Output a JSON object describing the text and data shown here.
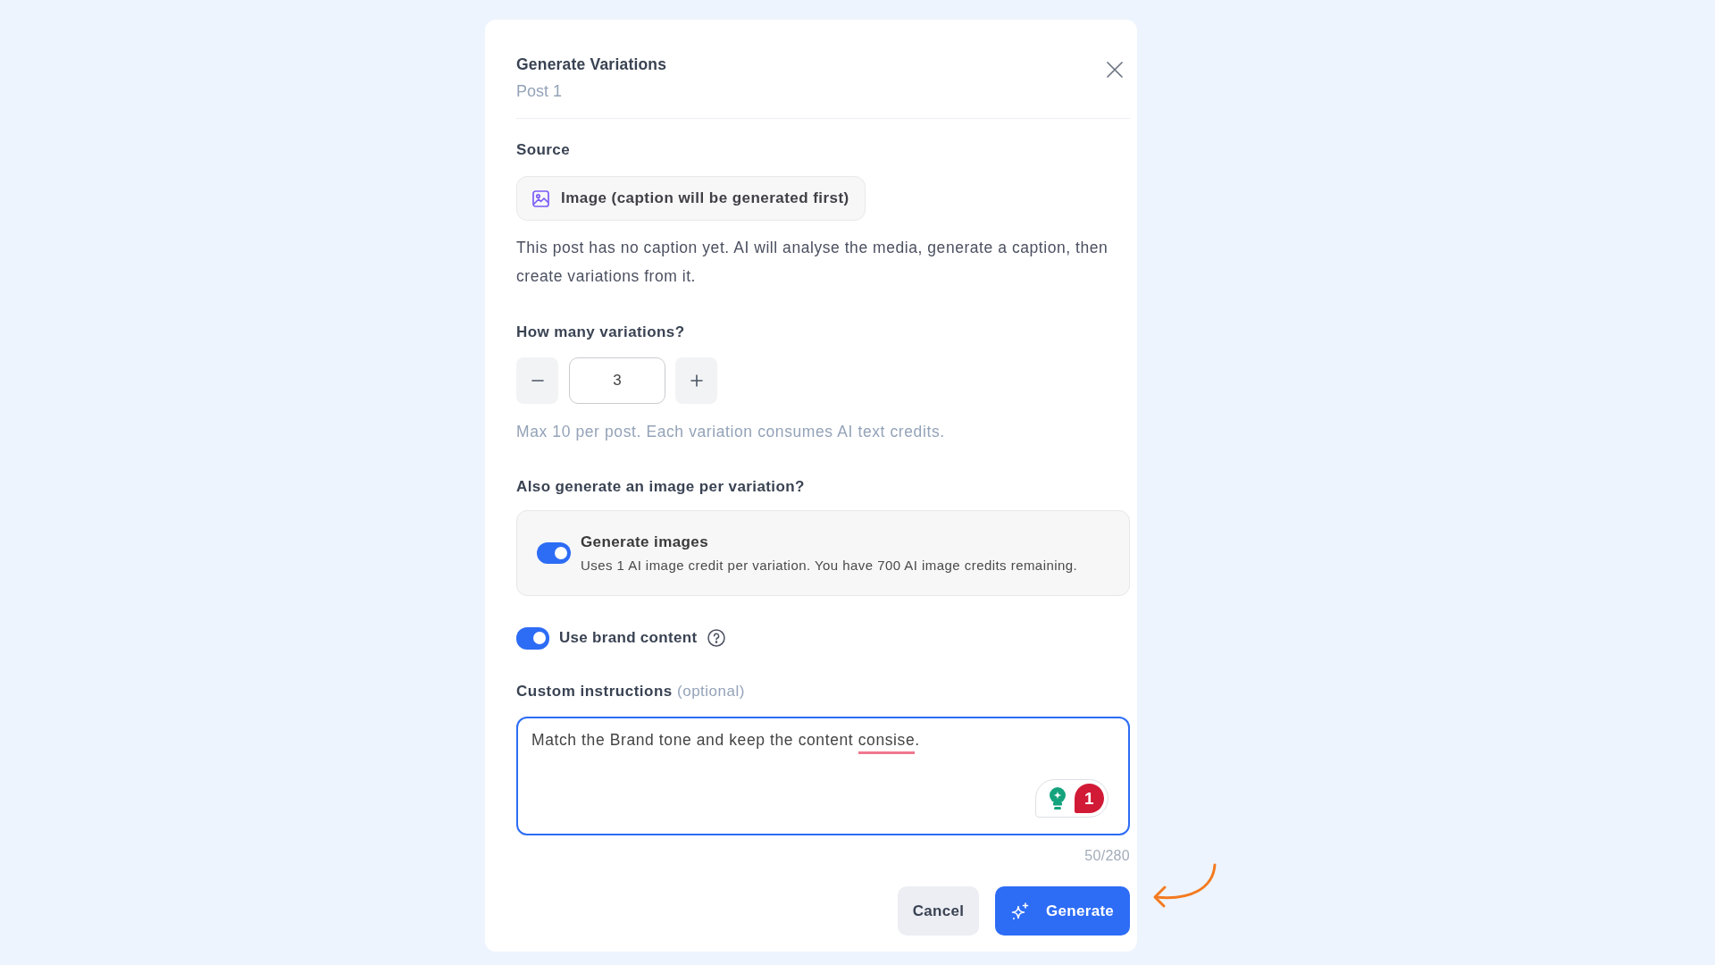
{
  "dialog": {
    "title": "Generate Variations",
    "subtitle": "Post 1"
  },
  "source": {
    "label": "Source",
    "option": "Image (caption will be generated first)",
    "note": "This post has no caption yet. AI will analyse the media, generate a caption, then create variations from it."
  },
  "variations": {
    "label": "How many variations?",
    "value": "3",
    "hint": "Max 10 per post. Each variation consumes AI text credits."
  },
  "image_generation": {
    "label": "Also generate an image per variation?",
    "toggle": {
      "title": "Generate images",
      "description": "Uses 1 AI image credit per variation. You have 700 AI image credits remaining.",
      "on": true
    }
  },
  "brand_content": {
    "label": "Use brand content",
    "on": true
  },
  "custom_instructions": {
    "label": "**Custom instructions** (optional)",
    "value_segments": [
      {
        "text": "Match the Brand tone and keep the content ",
        "misspelled": false
      },
      {
        "text": "consise",
        "misspelled": true
      },
      {
        "text": ".",
        "misspelled": false
      }
    ],
    "assistant_count": "1",
    "counter": "50/280"
  },
  "buttons": [
    {
      "label": "Cancel",
      "kind": "secondary"
    },
    {
      "label": "Generate",
      "kind": "primary"
    }
  ]
}
